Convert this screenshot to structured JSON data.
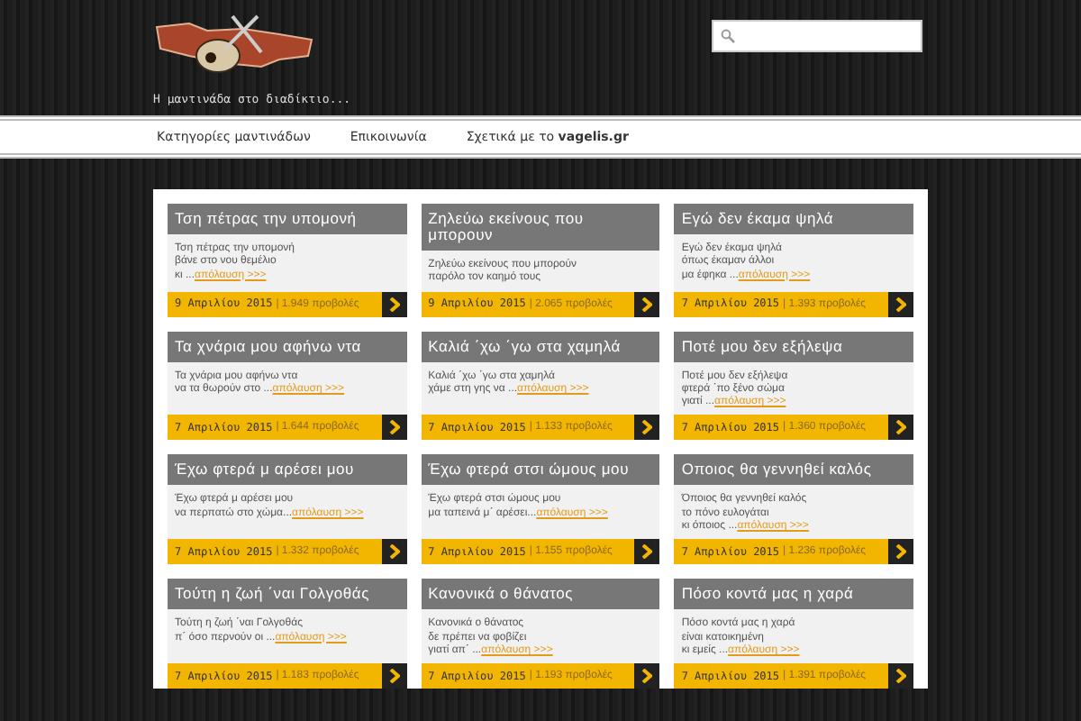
{
  "header": {
    "tagline": "Η μαντινάδα στο διαδίκτιο..."
  },
  "nav": {
    "items": [
      {
        "label": "Κατηγορίες μαντινάδων"
      },
      {
        "label": "Επικοινωνία"
      },
      {
        "label": "Σχετικά με το **vagelis.gr**"
      }
    ]
  },
  "posts": [
    {
      "title": "Τση πέτρας την υπομονή",
      "lines": [
        "Τση πέτρας την υπομονή",
        "βάνε στο νου θεμέλιο",
        "κι ..."
      ],
      "link": "απόλαυση >>>",
      "date": "9 Απριλίου 2015",
      "views": "| 1.949 προβολές"
    },
    {
      "title": "Ζηλεύω εκείνους που μπορουν",
      "lines": [
        "Ζηλεύω εκείνους που μπορούν",
        "παρόλο τον καημό τους"
      ],
      "date": "9 Απριλίου 2015",
      "views": "| 2.065 προβολές"
    },
    {
      "title": "Εγώ δεν έκαμα ψηλά",
      "lines": [
        "Εγώ δεν έκαμα ψηλά",
        "όπως έκαμαν άλλοι",
        "μα έφηκα ..."
      ],
      "link": "απόλαυση >>>",
      "date": "7 Απριλίου 2015",
      "views": "| 1.393 προβολές"
    },
    {
      "title": "Τα χνάρια μου αφήνω ντα",
      "lines": [
        "Τα χνάρια μου αφήνω ντα",
        "να τα θωρούν στο ..."
      ],
      "link": "απόλαυση >>>",
      "date": "7 Απριλίου 2015",
      "views": "| 1.644 προβολές"
    },
    {
      "title": "Καλιά ΄χω ΄γω στα χαμηλά",
      "lines": [
        "Καλιά ΄χω ΄γω στα χαμηλά",
        "χάμε στη γης να ..."
      ],
      "link": "απόλαυση >>>",
      "date": "7 Απριλίου 2015",
      "views": "| 1.133 προβολές"
    },
    {
      "title": "Ποτέ μου δεν εξήλεψα",
      "lines": [
        "Ποτέ μου δεν εξήλεψα",
        "φτερά ΄πο ξένο σώμα",
        "γιατί ..."
      ],
      "link": "απόλαυση >>>",
      "date": "7 Απριλίου 2015",
      "views": "| 1.360 προβολές"
    },
    {
      "title": "Έχω φτερά μ αρέσει μου",
      "lines": [
        "Έχω φτερά μ αρέσει μου",
        "να περπατώ στο χώμα..."
      ],
      "link": "απόλαυση >>>",
      "date": "7 Απριλίου 2015",
      "views": "| 1.332 προβολές"
    },
    {
      "title": "Έχω φτερά στσι ώμους μου",
      "lines": [
        "Έχω φτερά στσι ώμους μου",
        "μα ταπεινά μ΄ αρέσει..."
      ],
      "link": "απόλαυση >>>",
      "date": "7 Απριλίου 2015",
      "views": "| 1.155 προβολές"
    },
    {
      "title": "Οποιος θα γεννηθεί καλός",
      "lines": [
        "Όποιος θα γεννηθεί καλός",
        "το πόνο ευλογάται",
        "κι όποιος ..."
      ],
      "link": "απόλαυση >>>",
      "date": "7 Απριλίου 2015",
      "views": "| 1.236 προβολές"
    },
    {
      "title": "Τούτη η ζωή ΄ναι Γολγοθάς",
      "lines": [
        "Τούτη η ζωή ΄ναι Γολγοθάς",
        "π΄ όσο περνούν οι ..."
      ],
      "link": "απόλαυση >>>",
      "date": "7 Απριλίου 2015",
      "views": "| 1.183 προβολές"
    },
    {
      "title": "Κανονικά ο θάνατος",
      "lines": [
        "Κανονικά ο θάνατος",
        "δε πρέπει να φοβίζει",
        "γιατί απ΄ ..."
      ],
      "link": "απόλαυση >>>",
      "date": "7 Απριλίου 2015",
      "views": "| 1.193 προβολές"
    },
    {
      "title": "Πόσο κοντά μας η χαρά",
      "lines": [
        "Πόσο κοντά μας η χαρά",
        "είναι κατοικημένη",
        "κι εμείς ..."
      ],
      "link": "απόλαυση >>>",
      "date": "7 Απριλίου 2015",
      "views": "| 1.391 προβολές"
    }
  ]
}
